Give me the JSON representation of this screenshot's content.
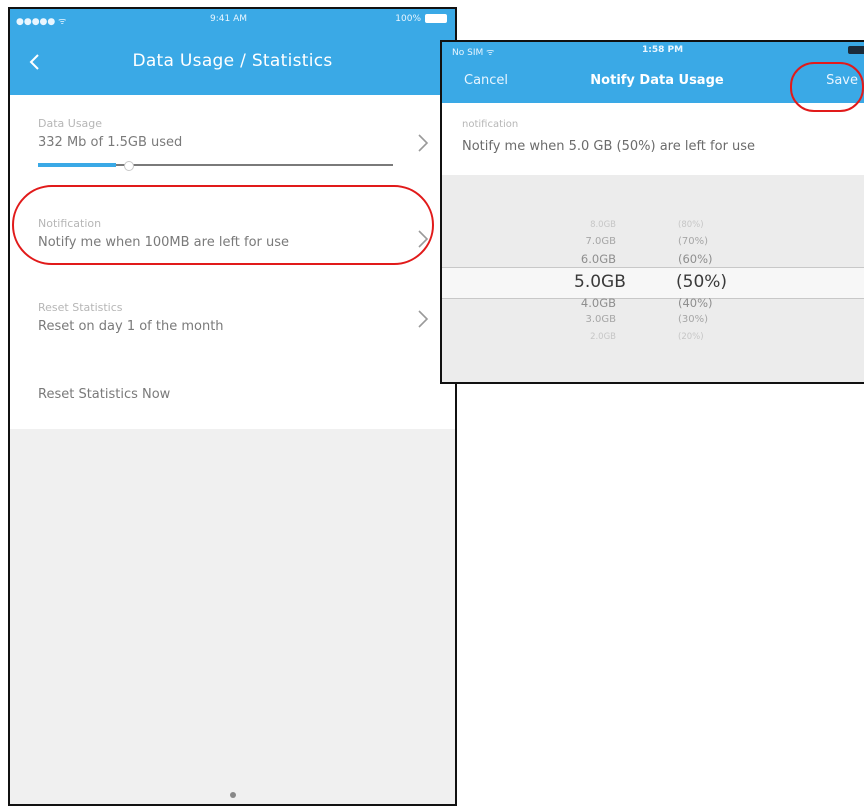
{
  "left": {
    "status": {
      "carrier": "●●●●● ᯤ",
      "time": "9:41 AM",
      "battery": "100%"
    },
    "title": "Data Usage / Statistics",
    "cells": {
      "usage": {
        "label": "Data Usage",
        "value": "332 Mb of 1.5GB used",
        "fraction": 0.22
      },
      "notification": {
        "label": "Notification",
        "value": "Notify me when 100MB are left for use"
      },
      "reset": {
        "label": "Reset Statistics",
        "value": "Reset on day 1 of the month"
      },
      "reset_now": {
        "label": "Reset Statistics Now"
      }
    }
  },
  "right": {
    "status": {
      "carrier": "No SIM ᯤ",
      "time": "1:58 PM"
    },
    "cancel": "Cancel",
    "title": "Notify Data Usage",
    "save": "Save",
    "cell": {
      "label": "notification",
      "value": "Notify me when 5.0 GB (50%) are left for use"
    },
    "picker": [
      {
        "gb": "8.0GB",
        "pct": "(80%)"
      },
      {
        "gb": "7.0GB",
        "pct": "(70%)"
      },
      {
        "gb": "6.0GB",
        "pct": "(60%)"
      },
      {
        "gb": "5.0GB",
        "pct": "(50%)",
        "selected": true
      },
      {
        "gb": "4.0GB",
        "pct": "(40%)"
      },
      {
        "gb": "3.0GB",
        "pct": "(30%)"
      },
      {
        "gb": "2.0GB",
        "pct": "(20%)"
      }
    ]
  },
  "colors": {
    "accent": "#3aa9e6",
    "highlight": "#e11a1a"
  },
  "icons": {
    "back": "chevron-left-icon",
    "disclosure": "chevron-right-icon"
  }
}
